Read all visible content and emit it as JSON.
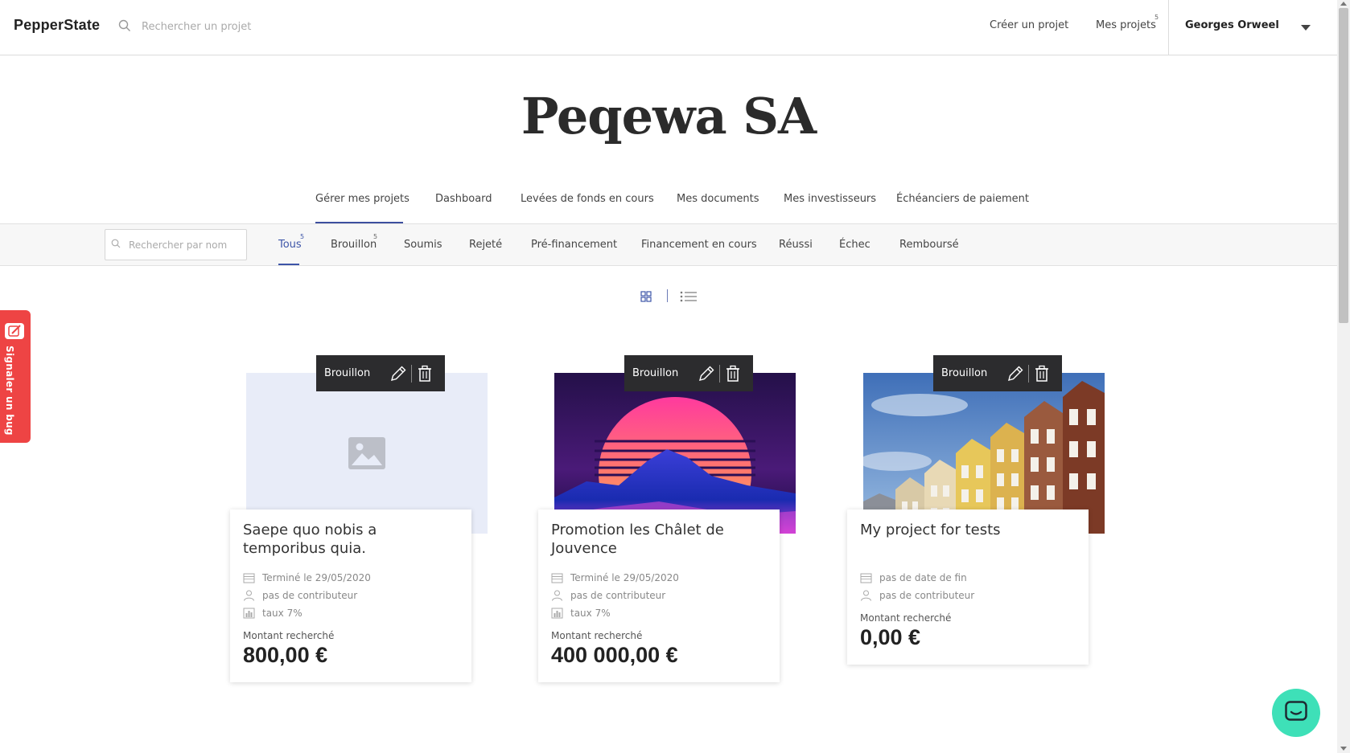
{
  "header": {
    "logo": "PepperState",
    "search_placeholder": "Rechercher un projet",
    "create_project": "Créer un projet",
    "my_projects": "Mes projets",
    "my_projects_count": "5",
    "user_name": "Georges Orweel"
  },
  "company": {
    "name": "Peqewa SA"
  },
  "main_nav": {
    "items": [
      {
        "label": "Gérer mes projets",
        "active": true
      },
      {
        "label": "Dashboard"
      },
      {
        "label": "Levées de fonds en cours"
      },
      {
        "label": "Mes documents"
      },
      {
        "label": "Mes investisseurs"
      },
      {
        "label": "Échéanciers de paiement"
      }
    ]
  },
  "filters": {
    "search_placeholder": "Rechercher par nom",
    "tabs": [
      {
        "label": "Tous",
        "count": "5",
        "active": true
      },
      {
        "label": "Brouillon",
        "count": "5"
      },
      {
        "label": "Soumis"
      },
      {
        "label": "Rejeté"
      },
      {
        "label": "Pré-financement"
      },
      {
        "label": "Financement en cours"
      },
      {
        "label": "Réussi"
      },
      {
        "label": "Échec"
      },
      {
        "label": "Remboursé"
      }
    ]
  },
  "bug_report": {
    "label": "Signaler un bug"
  },
  "amount_label": "Montant recherché",
  "projects": [
    {
      "status": "Brouillon",
      "title": "Saepe quo nobis a temporibus quia.",
      "end": "Terminé le 29/05/2020",
      "contributors": "pas de contributeur",
      "rate": "taux 7%",
      "amount": "800,00 €",
      "image": "placeholder-image"
    },
    {
      "status": "Brouillon",
      "title": "Promotion les Châlet de Jouvence",
      "end": "Terminé le 29/05/2020",
      "contributors": "pas de contributeur",
      "rate": "taux 7%",
      "amount": "400 000,00 €",
      "image": "synthwave-sunset-mountains"
    },
    {
      "status": "Brouillon",
      "title": "My project for tests",
      "end": "pas de date de fin",
      "contributors": "pas de contributeur",
      "amount": "0,00 €",
      "image": "colorful-townhouses"
    }
  ],
  "colors": {
    "accent": "#3d55a8",
    "status_bar": "#2c2c2e",
    "bug_tab": "#ee4444",
    "chat_button": "#3ee0b8",
    "placeholder_bg": "#e8ecf8"
  }
}
